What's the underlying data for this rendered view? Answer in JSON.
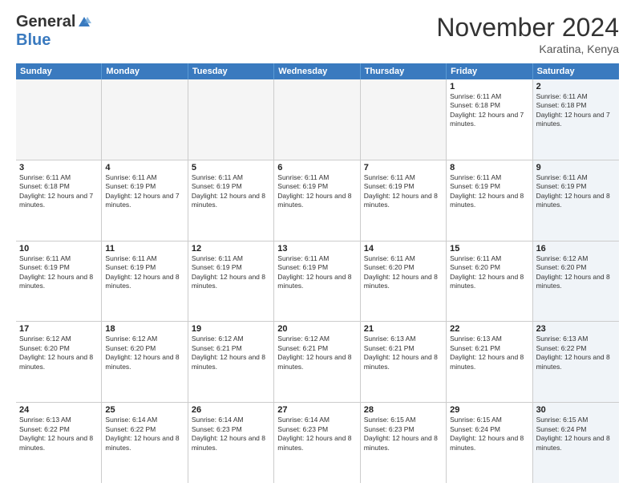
{
  "logo": {
    "general": "General",
    "blue": "Blue"
  },
  "title": "November 2024",
  "location": "Karatina, Kenya",
  "headers": [
    "Sunday",
    "Monday",
    "Tuesday",
    "Wednesday",
    "Thursday",
    "Friday",
    "Saturday"
  ],
  "rows": [
    [
      {
        "num": "",
        "text": "",
        "empty": true
      },
      {
        "num": "",
        "text": "",
        "empty": true
      },
      {
        "num": "",
        "text": "",
        "empty": true
      },
      {
        "num": "",
        "text": "",
        "empty": true
      },
      {
        "num": "",
        "text": "",
        "empty": true
      },
      {
        "num": "1",
        "text": "Sunrise: 6:11 AM\nSunset: 6:18 PM\nDaylight: 12 hours and 7 minutes.",
        "empty": false,
        "shade": false
      },
      {
        "num": "2",
        "text": "Sunrise: 6:11 AM\nSunset: 6:18 PM\nDaylight: 12 hours and 7 minutes.",
        "empty": false,
        "shade": true
      }
    ],
    [
      {
        "num": "3",
        "text": "Sunrise: 6:11 AM\nSunset: 6:18 PM\nDaylight: 12 hours and 7 minutes.",
        "empty": false,
        "shade": false
      },
      {
        "num": "4",
        "text": "Sunrise: 6:11 AM\nSunset: 6:19 PM\nDaylight: 12 hours and 7 minutes.",
        "empty": false,
        "shade": false
      },
      {
        "num": "5",
        "text": "Sunrise: 6:11 AM\nSunset: 6:19 PM\nDaylight: 12 hours and 8 minutes.",
        "empty": false,
        "shade": false
      },
      {
        "num": "6",
        "text": "Sunrise: 6:11 AM\nSunset: 6:19 PM\nDaylight: 12 hours and 8 minutes.",
        "empty": false,
        "shade": false
      },
      {
        "num": "7",
        "text": "Sunrise: 6:11 AM\nSunset: 6:19 PM\nDaylight: 12 hours and 8 minutes.",
        "empty": false,
        "shade": false
      },
      {
        "num": "8",
        "text": "Sunrise: 6:11 AM\nSunset: 6:19 PM\nDaylight: 12 hours and 8 minutes.",
        "empty": false,
        "shade": false
      },
      {
        "num": "9",
        "text": "Sunrise: 6:11 AM\nSunset: 6:19 PM\nDaylight: 12 hours and 8 minutes.",
        "empty": false,
        "shade": true
      }
    ],
    [
      {
        "num": "10",
        "text": "Sunrise: 6:11 AM\nSunset: 6:19 PM\nDaylight: 12 hours and 8 minutes.",
        "empty": false,
        "shade": false
      },
      {
        "num": "11",
        "text": "Sunrise: 6:11 AM\nSunset: 6:19 PM\nDaylight: 12 hours and 8 minutes.",
        "empty": false,
        "shade": false
      },
      {
        "num": "12",
        "text": "Sunrise: 6:11 AM\nSunset: 6:19 PM\nDaylight: 12 hours and 8 minutes.",
        "empty": false,
        "shade": false
      },
      {
        "num": "13",
        "text": "Sunrise: 6:11 AM\nSunset: 6:19 PM\nDaylight: 12 hours and 8 minutes.",
        "empty": false,
        "shade": false
      },
      {
        "num": "14",
        "text": "Sunrise: 6:11 AM\nSunset: 6:20 PM\nDaylight: 12 hours and 8 minutes.",
        "empty": false,
        "shade": false
      },
      {
        "num": "15",
        "text": "Sunrise: 6:11 AM\nSunset: 6:20 PM\nDaylight: 12 hours and 8 minutes.",
        "empty": false,
        "shade": false
      },
      {
        "num": "16",
        "text": "Sunrise: 6:12 AM\nSunset: 6:20 PM\nDaylight: 12 hours and 8 minutes.",
        "empty": false,
        "shade": true
      }
    ],
    [
      {
        "num": "17",
        "text": "Sunrise: 6:12 AM\nSunset: 6:20 PM\nDaylight: 12 hours and 8 minutes.",
        "empty": false,
        "shade": false
      },
      {
        "num": "18",
        "text": "Sunrise: 6:12 AM\nSunset: 6:20 PM\nDaylight: 12 hours and 8 minutes.",
        "empty": false,
        "shade": false
      },
      {
        "num": "19",
        "text": "Sunrise: 6:12 AM\nSunset: 6:21 PM\nDaylight: 12 hours and 8 minutes.",
        "empty": false,
        "shade": false
      },
      {
        "num": "20",
        "text": "Sunrise: 6:12 AM\nSunset: 6:21 PM\nDaylight: 12 hours and 8 minutes.",
        "empty": false,
        "shade": false
      },
      {
        "num": "21",
        "text": "Sunrise: 6:13 AM\nSunset: 6:21 PM\nDaylight: 12 hours and 8 minutes.",
        "empty": false,
        "shade": false
      },
      {
        "num": "22",
        "text": "Sunrise: 6:13 AM\nSunset: 6:21 PM\nDaylight: 12 hours and 8 minutes.",
        "empty": false,
        "shade": false
      },
      {
        "num": "23",
        "text": "Sunrise: 6:13 AM\nSunset: 6:22 PM\nDaylight: 12 hours and 8 minutes.",
        "empty": false,
        "shade": true
      }
    ],
    [
      {
        "num": "24",
        "text": "Sunrise: 6:13 AM\nSunset: 6:22 PM\nDaylight: 12 hours and 8 minutes.",
        "empty": false,
        "shade": false
      },
      {
        "num": "25",
        "text": "Sunrise: 6:14 AM\nSunset: 6:22 PM\nDaylight: 12 hours and 8 minutes.",
        "empty": false,
        "shade": false
      },
      {
        "num": "26",
        "text": "Sunrise: 6:14 AM\nSunset: 6:23 PM\nDaylight: 12 hours and 8 minutes.",
        "empty": false,
        "shade": false
      },
      {
        "num": "27",
        "text": "Sunrise: 6:14 AM\nSunset: 6:23 PM\nDaylight: 12 hours and 8 minutes.",
        "empty": false,
        "shade": false
      },
      {
        "num": "28",
        "text": "Sunrise: 6:15 AM\nSunset: 6:23 PM\nDaylight: 12 hours and 8 minutes.",
        "empty": false,
        "shade": false
      },
      {
        "num": "29",
        "text": "Sunrise: 6:15 AM\nSunset: 6:24 PM\nDaylight: 12 hours and 8 minutes.",
        "empty": false,
        "shade": false
      },
      {
        "num": "30",
        "text": "Sunrise: 6:15 AM\nSunset: 6:24 PM\nDaylight: 12 hours and 8 minutes.",
        "empty": false,
        "shade": true
      }
    ]
  ]
}
